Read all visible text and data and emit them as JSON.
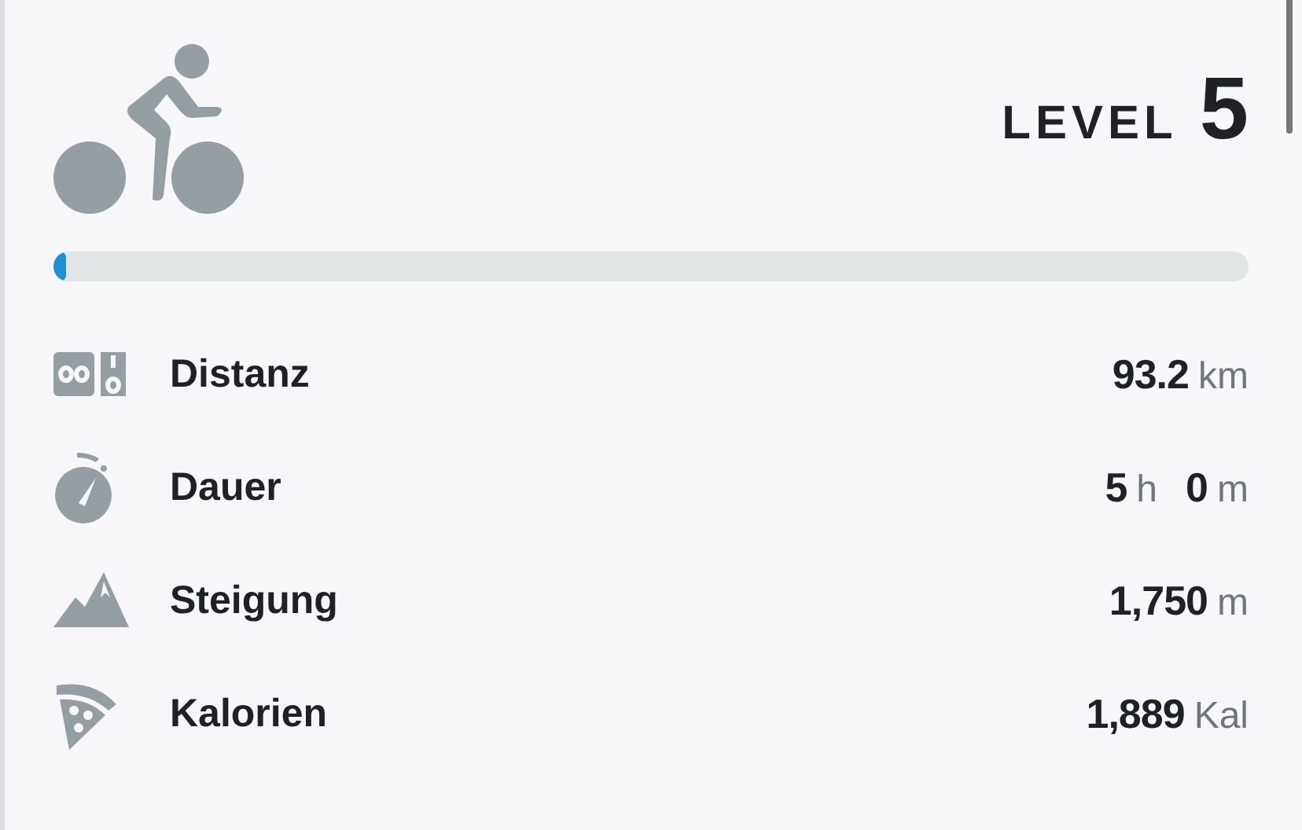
{
  "level": {
    "label": "LEVEL",
    "number": "5",
    "level": 0.01
  },
  "stats": [
    {
      "kind": "distance",
      "label": "Distanz",
      "parts": [
        {
          "number": "93.2",
          "unit": "km"
        }
      ]
    },
    {
      "kind": "duration",
      "label": "Dauer",
      "parts": [
        {
          "number": "5",
          "unit": "h"
        },
        {
          "number": "0",
          "unit": "m"
        }
      ]
    },
    {
      "kind": "elevation",
      "label": "Steigung",
      "parts": [
        {
          "number": "1,750",
          "unit": "m"
        }
      ]
    },
    {
      "kind": "calories",
      "label": "Kalorien",
      "parts": [
        {
          "number": "1,889",
          "unit": "Kal"
        }
      ]
    }
  ]
}
